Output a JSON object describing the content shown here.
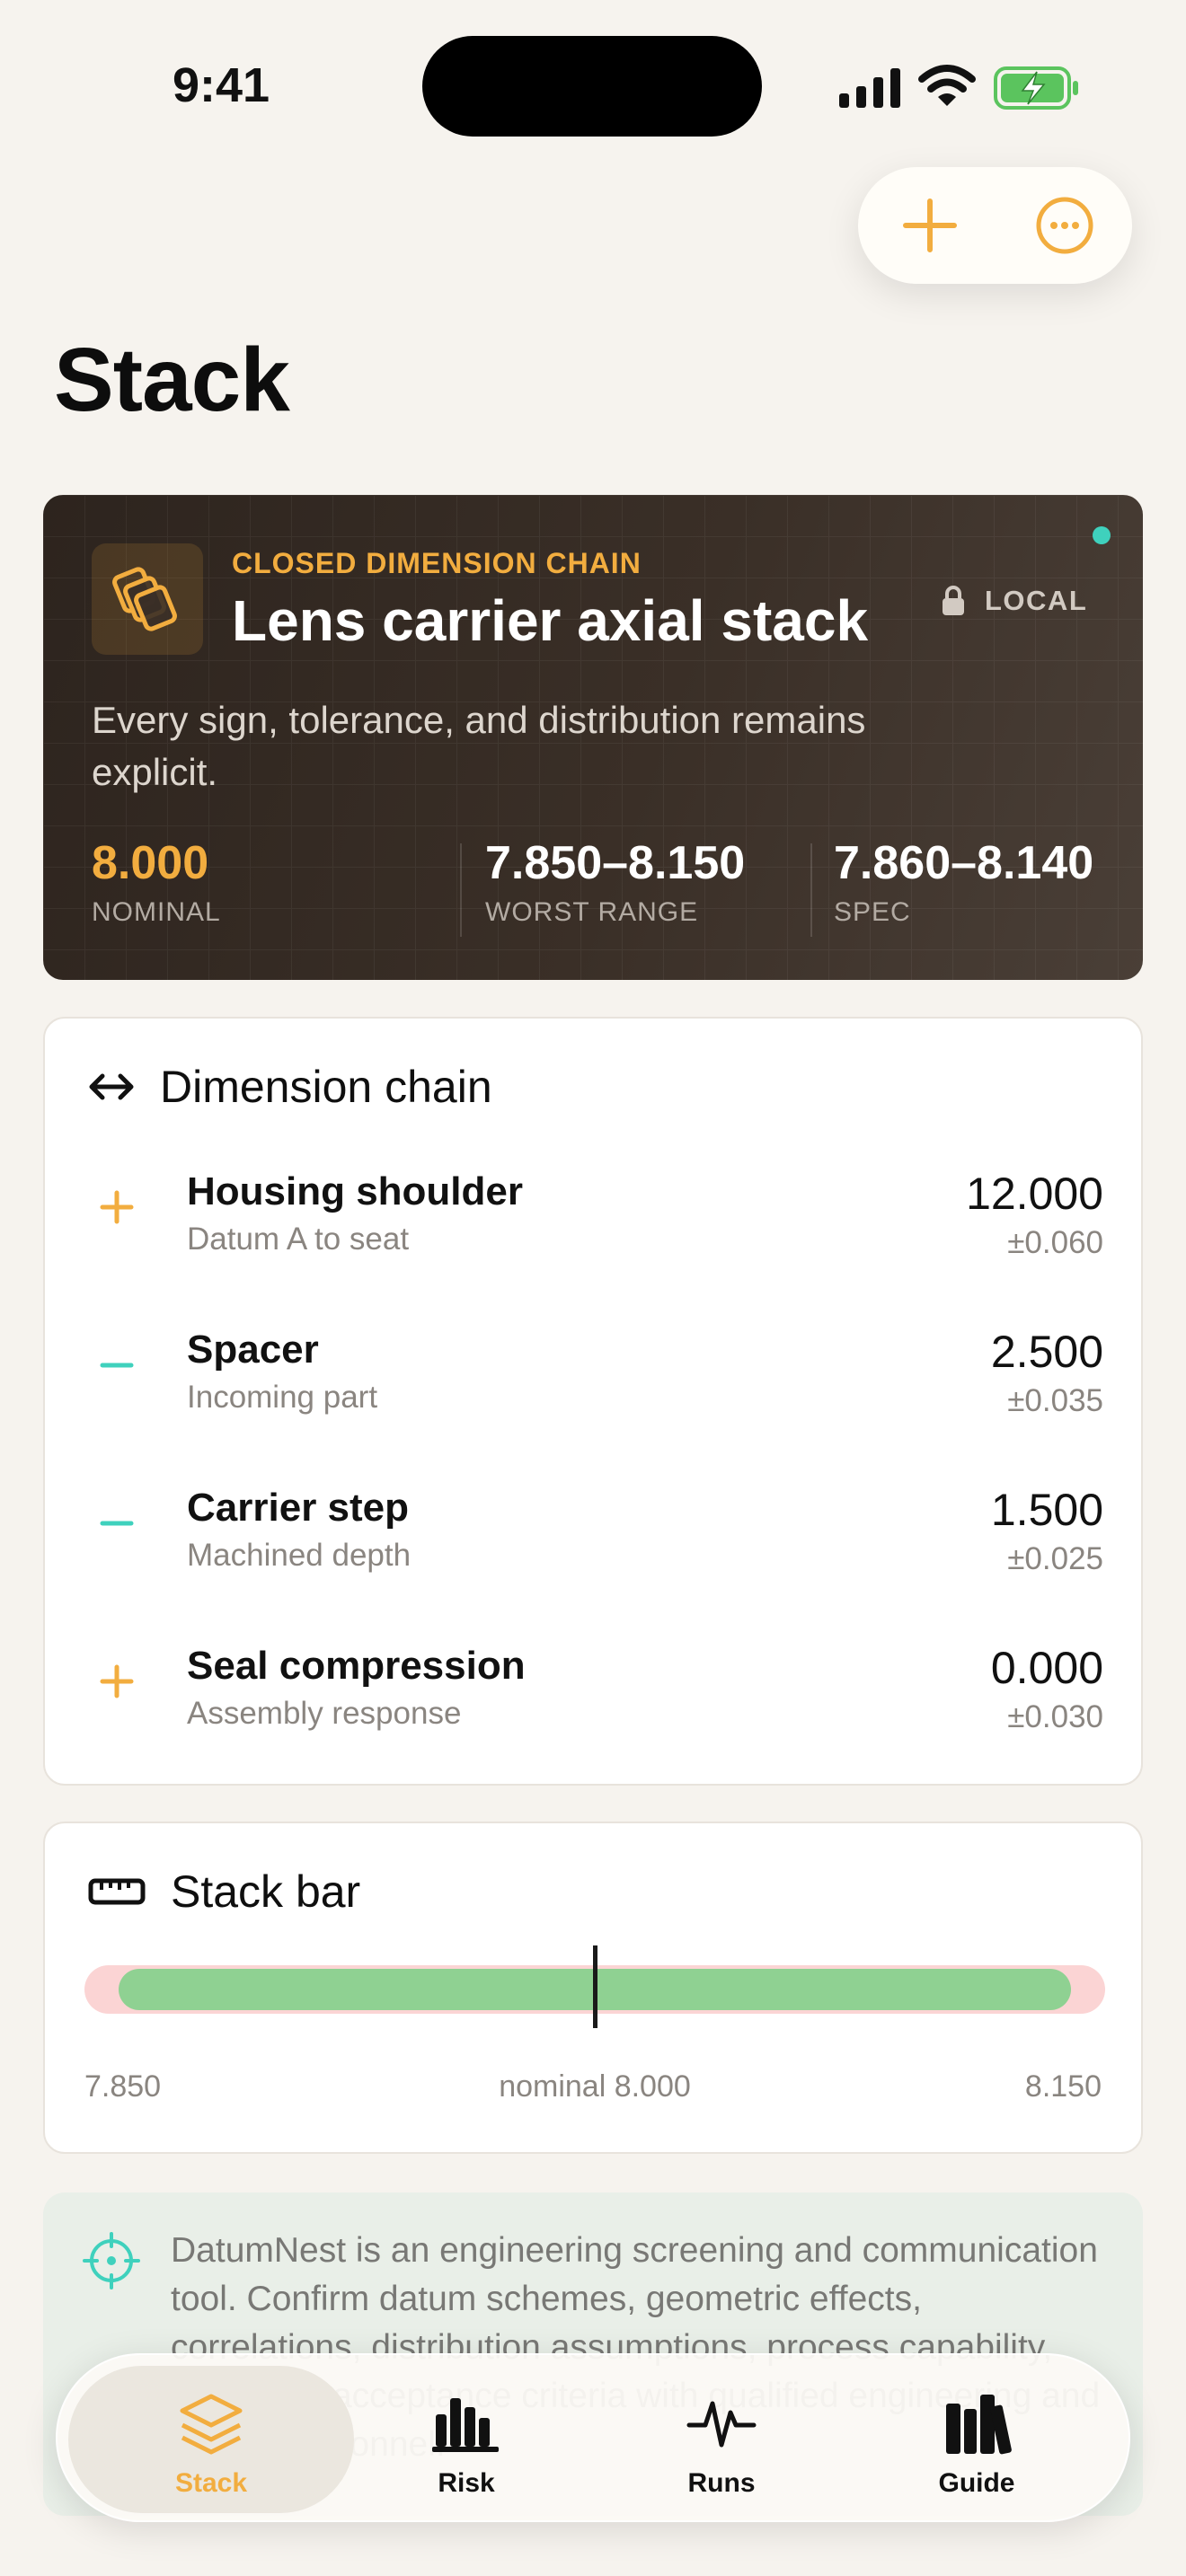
{
  "status_bar": {
    "time": "9:41"
  },
  "page": {
    "title": "Stack"
  },
  "hero": {
    "kicker": "CLOSED DIMENSION CHAIN",
    "title": "Lens carrier axial stack",
    "local_label": "LOCAL",
    "subtitle": "Every sign, tolerance, and distribution remains explicit.",
    "stats": [
      {
        "value": "8.000",
        "label": "NOMINAL"
      },
      {
        "value": "7.850–8.150",
        "label": "WORST RANGE"
      },
      {
        "value": "7.860–8.140",
        "label": "SPEC"
      }
    ]
  },
  "chain": {
    "title": "Dimension chain",
    "rows": [
      {
        "sign": "+",
        "name": "Housing shoulder",
        "desc": "Datum A to seat",
        "value": "12.000",
        "tol": "±0.060"
      },
      {
        "sign": "−",
        "name": "Spacer",
        "desc": "Incoming part",
        "value": "2.500",
        "tol": "±0.035"
      },
      {
        "sign": "−",
        "name": "Carrier step",
        "desc": "Machined depth",
        "value": "1.500",
        "tol": "±0.025"
      },
      {
        "sign": "+",
        "name": "Seal compression",
        "desc": "Assembly response",
        "value": "0.000",
        "tol": "±0.030"
      }
    ]
  },
  "stack_bar": {
    "title": "Stack bar",
    "min_label": "7.850",
    "mid_label": "nominal 8.000",
    "max_label": "8.150",
    "range_min": 7.85,
    "range_max": 8.15,
    "spec_min": 7.86,
    "spec_max": 8.14,
    "nominal": 8.0
  },
  "notice": {
    "text": "DatumNest is an engineering screening and communication tool. Confirm datum schemes, geometric effects, correlations, distribution assumptions, process capability, units, and acceptance criteria with qualified engineering and quality personnel."
  },
  "tabs": [
    {
      "label": "Stack",
      "active": true
    },
    {
      "label": "Risk",
      "active": false
    },
    {
      "label": "Runs",
      "active": false
    },
    {
      "label": "Guide",
      "active": false
    }
  ],
  "colors": {
    "accent": "#f2ad3f",
    "teal": "#3fd1bd",
    "bar_in_spec": "#8fd192",
    "bar_out_spec": "#fbd4d4"
  }
}
